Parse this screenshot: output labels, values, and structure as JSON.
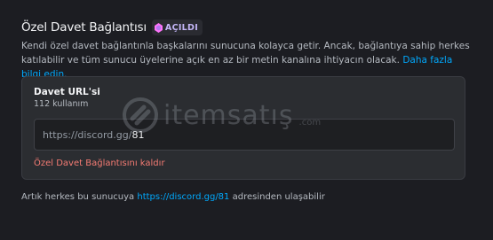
{
  "header": {
    "title": "Özel Davet Bağlantısı",
    "badge_label": "AÇILDI",
    "badge_icon": "boost-gem-icon"
  },
  "description": {
    "text": "Kendi özel davet bağlantınla başkalarını sunucuna kolayca getir. Ancak, bağlantıya sahip herkes katılabilir ve tüm sunucu üyelerine açık en az bir metin kanalına ihtiyacın olacak.",
    "link_label": "Daha fazla bilgi edin."
  },
  "invite_card": {
    "title": "Davet URL'si",
    "usage": "112 kullanım",
    "url_prefix": "https://discord.gg/",
    "url_value": "81",
    "remove_label": "Özel Davet Bağlantısını kaldır"
  },
  "footer": {
    "prefix": "Artık herkes bu sunucuya ",
    "link": "https://discord.gg/81",
    "suffix": " adresinden ulaşabilir"
  },
  "watermark": {
    "text": "itemsatış",
    "sub": ".com"
  },
  "colors": {
    "background": "#1c1d22",
    "card": "#2b2d31",
    "link": "#00a8fc",
    "danger": "#f47b73",
    "badge_text": "#c4b6f7"
  }
}
